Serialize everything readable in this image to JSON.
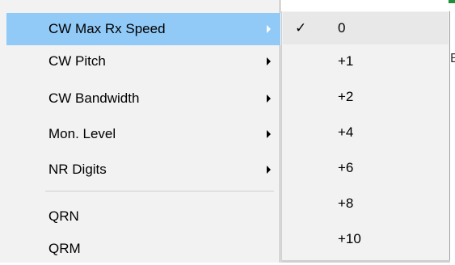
{
  "menu": {
    "items": [
      {
        "label": "CW Max Rx Speed",
        "has_submenu": true,
        "highlighted": true
      },
      {
        "label": "CW Pitch",
        "has_submenu": true
      },
      {
        "label": "CW Bandwidth",
        "has_submenu": true
      },
      {
        "label": "Mon. Level",
        "has_submenu": true
      },
      {
        "label": "NR Digits",
        "has_submenu": true
      },
      {
        "label": "QRN",
        "has_submenu": false
      },
      {
        "label": "QRM",
        "has_submenu": false
      }
    ],
    "highlight_color": "#91c9f7",
    "background_color": "#f2f2f2"
  },
  "submenu": {
    "items": [
      {
        "value": "0",
        "checked": true
      },
      {
        "value": "+1"
      },
      {
        "value": "+2"
      },
      {
        "value": "+4"
      },
      {
        "value": "+6"
      },
      {
        "value": "+8"
      },
      {
        "value": "+10"
      }
    ],
    "check_glyph": "✓"
  },
  "backdrop": {
    "edge_text": "E"
  },
  "icons": {
    "submenu_arrow": "chevron-right-icon",
    "check": "check-icon"
  }
}
